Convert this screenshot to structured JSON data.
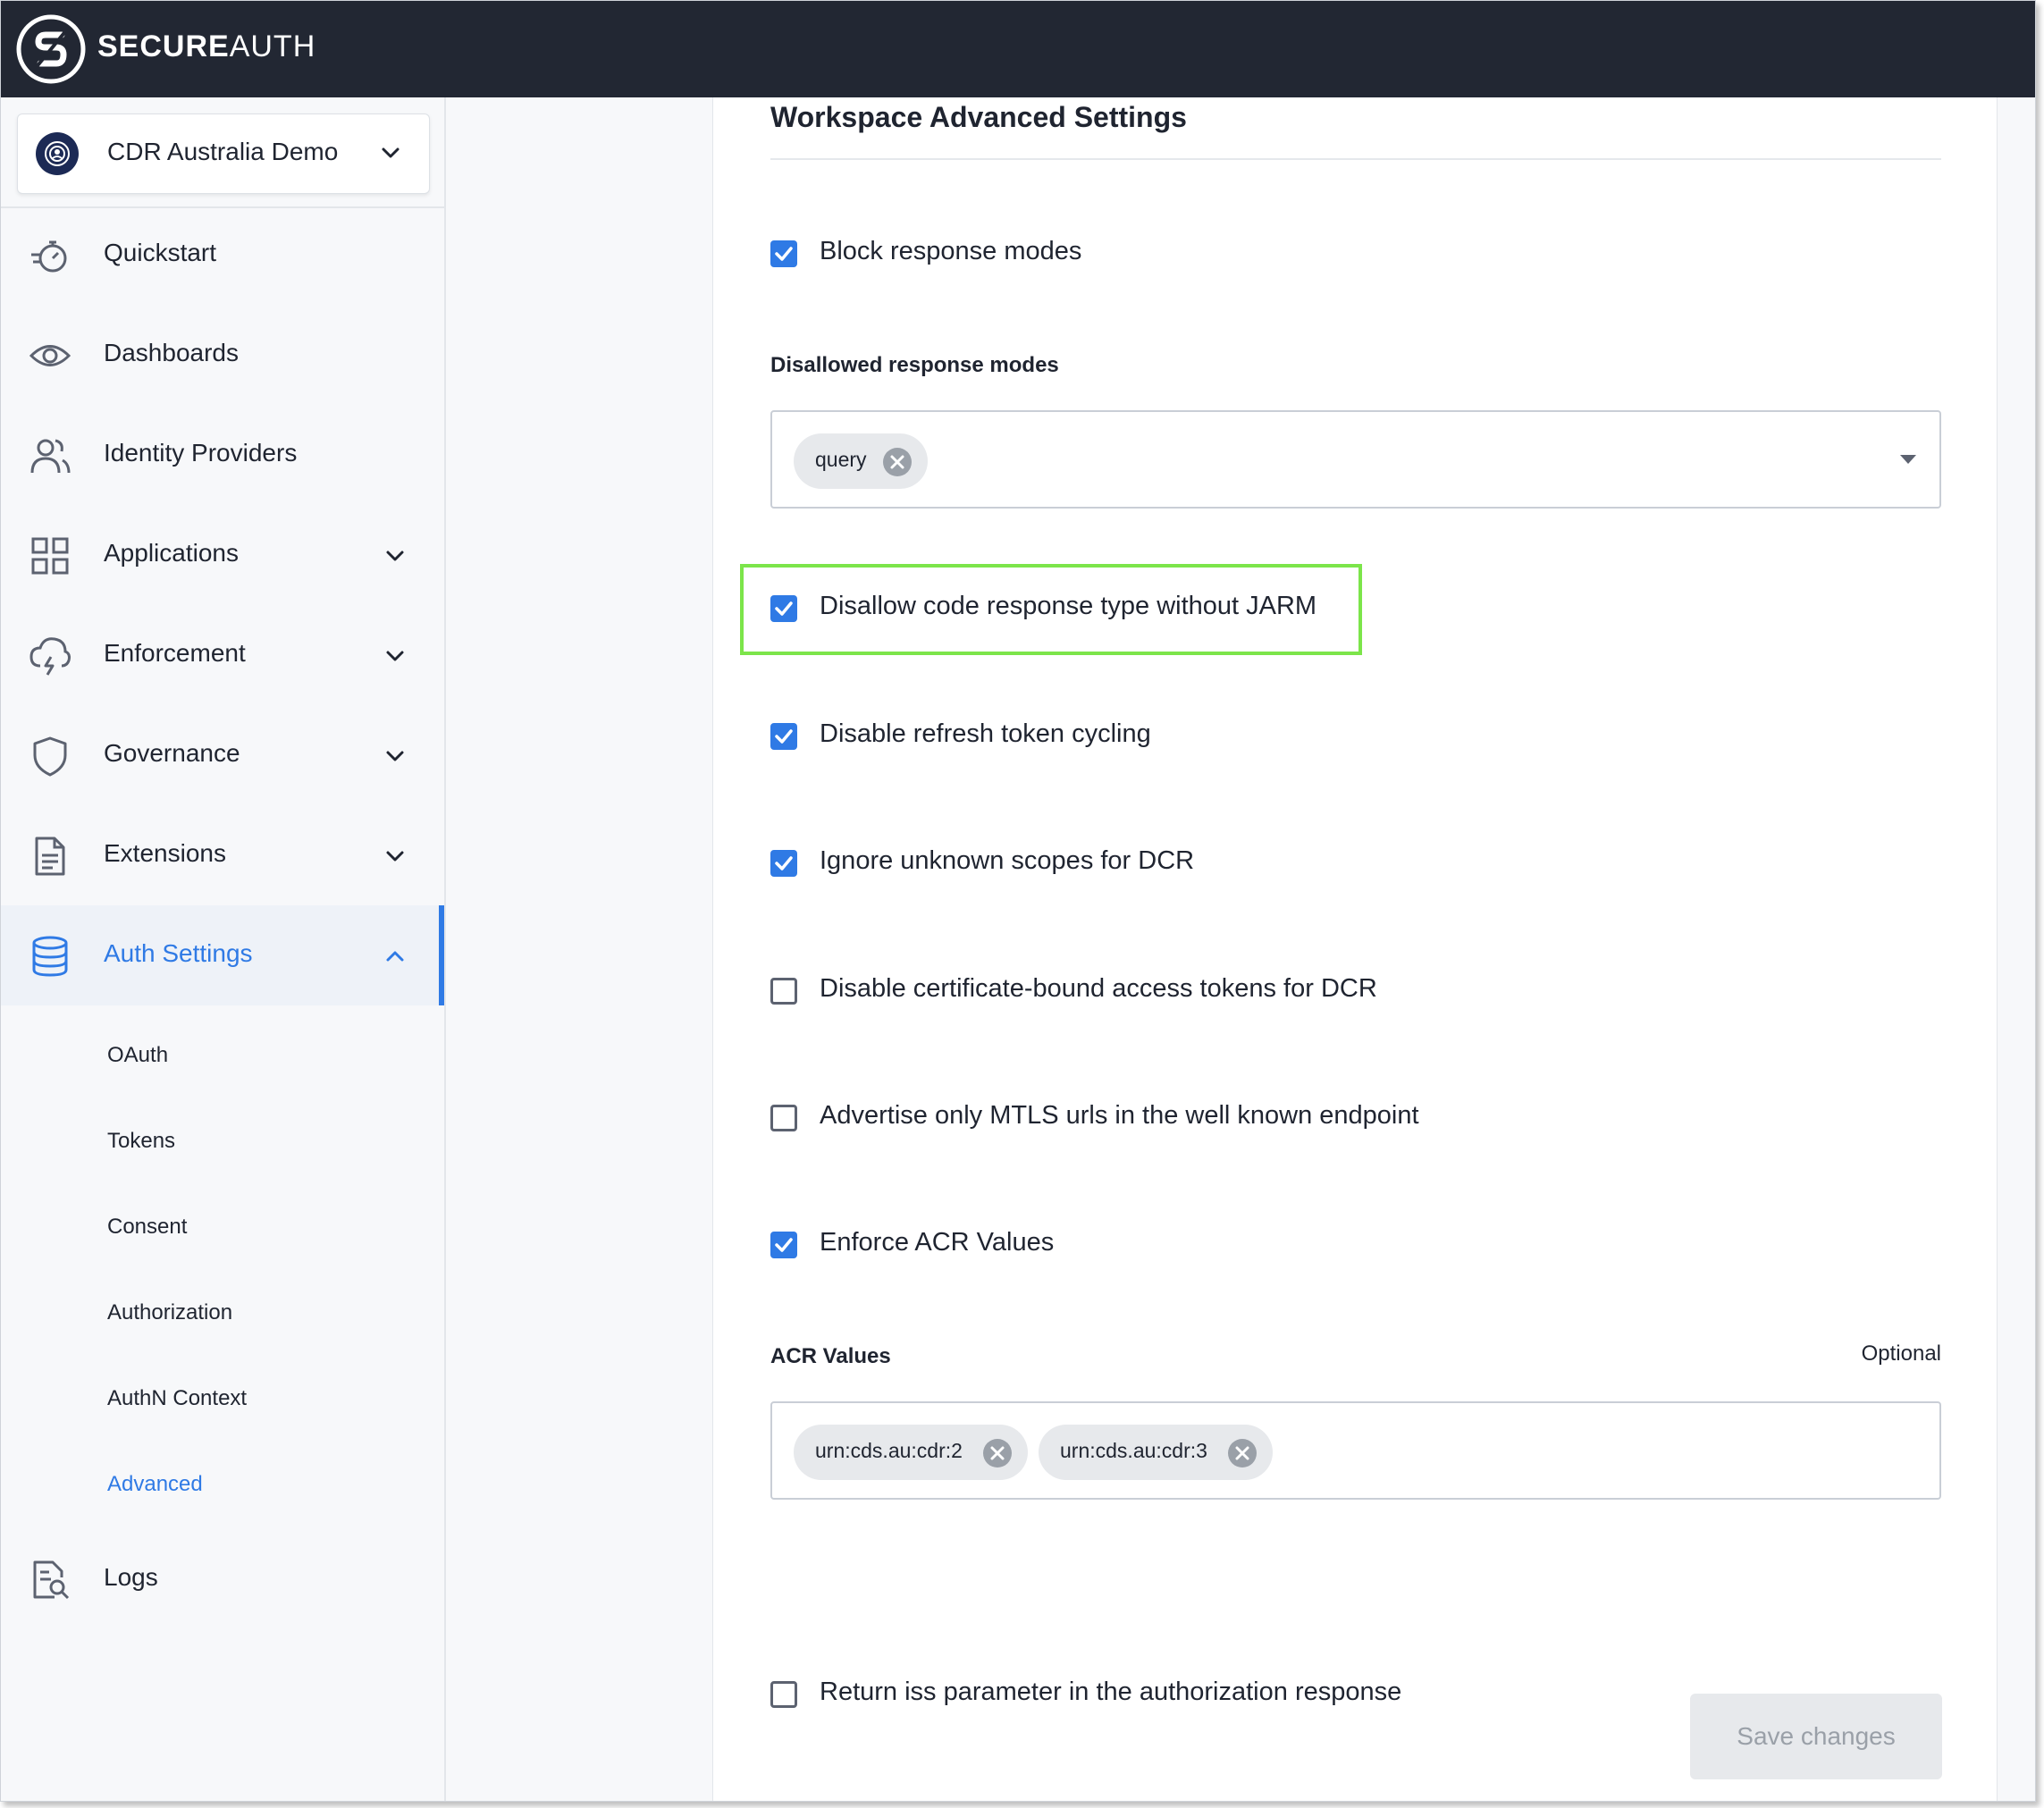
{
  "brand": {
    "bold": "SECURE",
    "light": "AUTH"
  },
  "workspace": {
    "name": "CDR Australia Demo"
  },
  "nav": [
    {
      "label": "Quickstart",
      "icon": "stopwatch-icon"
    },
    {
      "label": "Dashboards",
      "icon": "eye-icon"
    },
    {
      "label": "Identity Providers",
      "icon": "users-icon"
    },
    {
      "label": "Applications",
      "icon": "grid-icon"
    },
    {
      "label": "Enforcement",
      "icon": "cloud-lightning-icon"
    },
    {
      "label": "Governance",
      "icon": "shield-icon"
    },
    {
      "label": "Extensions",
      "icon": "document-icon"
    },
    {
      "label": "Auth Settings",
      "icon": "database-icon"
    },
    {
      "label": "Logs",
      "icon": "log-search-icon"
    }
  ],
  "auth_settings_sub": [
    "OAuth",
    "Tokens",
    "Consent",
    "Authorization",
    "AuthN Context",
    "Advanced"
  ],
  "page": {
    "title": "Workspace Advanced Settings",
    "block_response_modes": {
      "label": "Block response modes",
      "checked": true
    },
    "disallowed_response_modes": {
      "label": "Disallowed response modes",
      "chips": [
        "query"
      ]
    },
    "disallow_code_without_jarm": {
      "label": "Disallow code response type without JARM",
      "checked": true
    },
    "disable_refresh_token_cycling": {
      "label": "Disable refresh token cycling",
      "checked": true
    },
    "ignore_unknown_scopes": {
      "label": "Ignore unknown scopes for DCR",
      "checked": true
    },
    "disable_cert_bound_tokens": {
      "label": "Disable certificate-bound access tokens for DCR",
      "checked": false
    },
    "advertise_mtls_only": {
      "label": "Advertise only MTLS urls in the well known endpoint",
      "checked": false
    },
    "enforce_acr_values": {
      "label": "Enforce ACR Values",
      "checked": true
    },
    "acr_values": {
      "label": "ACR Values",
      "optional": "Optional",
      "chips": [
        "urn:cds.au:cdr:2",
        "urn:cds.au:cdr:3"
      ]
    },
    "return_iss": {
      "label": "Return iss parameter in the authorization response",
      "checked": false
    },
    "save_label": "Save changes"
  },
  "colors": {
    "accent": "#2f7ae5",
    "topbar": "#222733",
    "highlight": "#7ce54a"
  }
}
